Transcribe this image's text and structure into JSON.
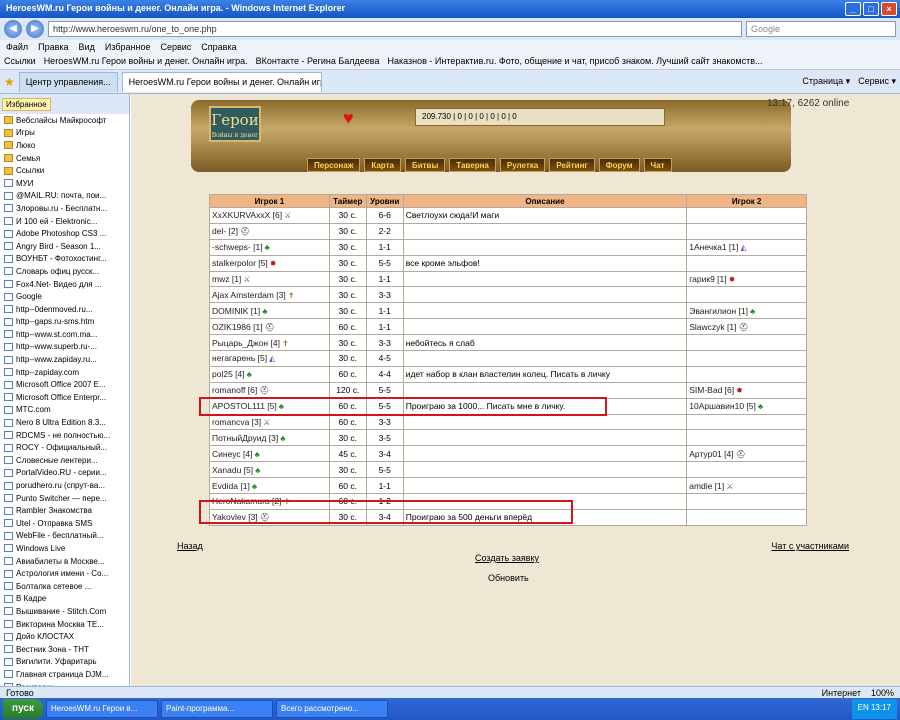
{
  "window": {
    "title": "HeroesWM.ru Герои войны и денег. Онлайн игра. - Windows Internet Explorer",
    "minimize": "_",
    "maximize": "□",
    "close": "×"
  },
  "address": {
    "url": "http://www.heroeswm.ru/one_to_one.php",
    "search_placeholder": "Google",
    "back": "◀",
    "forward": "▶"
  },
  "menu": [
    "Файл",
    "Правка",
    "Вид",
    "Избранное",
    "Сервис",
    "Справка"
  ],
  "links": [
    "Ссылки",
    "HeroesWM.ru Герои войны и денег. Онлайн игра.",
    "ВКонтакте - Регина Балдеева",
    "Наказнов - Интерактив.ru. Фото, общение и чат, присоб знаком. Лучший сайт знакомств..."
  ],
  "tabs": [
    "Центр управления...",
    "HeroesWM.ru Герои войны и денег. Онлайн игра."
  ],
  "tab_tools": [
    "Страница ▾",
    "Сервис ▾"
  ],
  "sidebar": {
    "fav_label": "Избранное",
    "items": [
      "Вебслайсы Майкрософт",
      "Игры",
      "Люко",
      "Семья",
      "Ссылки",
      "МУИ",
      "@MAIL.RU: почта, пои...",
      "Злоровы.ru - Бесплатн...",
      "И 100 ей - Elektronic...",
      "Adobe Photoshop CS3 ...",
      "Angry Bird - Season 1...",
      "ВОУНБТ - Фотохостинг...",
      "Словарь офиц русск...",
      "Fox4.Net- Видео для ...",
      "Google",
      "http--0denmoved.ru...",
      "http--gaps.ru-sms.htm",
      "http--www.st.com.ma...",
      "http--www.superb.ru-...",
      "http--www.zapiday.ru...",
      "http--zapiday.com",
      "Microsoft Office 2007 E...",
      "Microsoft Office Enterpr...",
      "МТС.com",
      "Nero 8 Ultra Edition 8.3...",
      "RDCMS - не полностью...",
      "ROCY - Официальный...",
      "Словесные лентери...",
      "PortalVideo.RU - серии...",
      "porudhero.ru (спрут-ва...",
      "Punto Switcher — пере...",
      "Rambler Знакомства",
      "Utel - Отправка SMS",
      "WebFile - бесплатный...",
      "Windows Live",
      "Авиабилеты в Москве...",
      "Астрология имени - Со...",
      "Болталка сетевое ...",
      "В Кадре",
      "Вышивание - Stitch.Com",
      "Викторина Москва ТЕ...",
      "Дойо КЛОСТАХ",
      "Вестник Зона - ТНТ",
      "Вигилити. Уфаритарь",
      "Главная страница DJM...",
      "Раскраски"
    ]
  },
  "game": {
    "logo": "Герои",
    "logo_sub": "Войны и денег",
    "heart_icon": "heart-icon",
    "resources": "209.730 | 0 | 0 | 0 | 0 | 0 | 0",
    "clock": "13:17, 6262 online",
    "nav": [
      "Персонаж",
      "Карта",
      "Битвы",
      "Таверна",
      "Рулетка",
      "Рейтинг",
      "Форум",
      "Чат"
    ]
  },
  "table": {
    "headers": [
      "Игрок 1",
      "Таймер",
      "Уровни",
      "Описание",
      "Игрок 2"
    ],
    "rows": [
      {
        "p1": "XxXKURVAxxX [6]",
        "i1": "sword",
        "t": "30 с.",
        "l": "6-6",
        "d": "Светлоухи сюда!И маги",
        "p2": "",
        "i2": ""
      },
      {
        "p1": "del- [2]",
        "i1": "helm",
        "t": "30 с.",
        "l": "2-2",
        "d": "",
        "p2": "",
        "i2": ""
      },
      {
        "p1": "-schweps- [1]",
        "i1": "tree",
        "t": "30 с.",
        "l": "1-1",
        "d": "",
        "p2": "1Анечка1 [1]",
        "i2": "mage"
      },
      {
        "p1": "stalkerpolor [5]",
        "i1": "star",
        "t": "30 с.",
        "l": "5-5",
        "d": "все кроме эльфов!",
        "p2": "",
        "i2": ""
      },
      {
        "p1": "mwz [1]",
        "i1": "sword",
        "t": "30 с.",
        "l": "1-1",
        "d": "",
        "p2": "гарик9 [1]",
        "i2": "star"
      },
      {
        "p1": "Ajax Amsterdam [3]",
        "i1": "cross",
        "t": "30 с.",
        "l": "3-3",
        "d": "",
        "p2": "",
        "i2": ""
      },
      {
        "p1": "DOMINIK [1]",
        "i1": "tree",
        "t": "30 с.",
        "l": "1-1",
        "d": "",
        "p2": "Эвангилион [1]",
        "i2": "tree"
      },
      {
        "p1": "OZIK1986 [1]",
        "i1": "helm",
        "t": "60 с.",
        "l": "1-1",
        "d": "",
        "p2": "Slawczyk [1]",
        "i2": "helm"
      },
      {
        "p1": "Рыцарь_Джон [4]",
        "i1": "cross",
        "t": "30 с.",
        "l": "3-3",
        "d": "небойтесь я слаб",
        "p2": "",
        "i2": ""
      },
      {
        "p1": "негагарень [5]",
        "i1": "mage",
        "t": "30 с.",
        "l": "4-5",
        "d": "",
        "p2": "",
        "i2": ""
      },
      {
        "p1": "pol25 [4]",
        "i1": "tree",
        "t": "60 с.",
        "l": "4-4",
        "d": "идет набор в клан властелин колец. Писать в личку",
        "p2": "",
        "i2": ""
      },
      {
        "p1": "romanoff [6]",
        "i1": "helm",
        "t": "120 с.",
        "l": "5-5",
        "d": "",
        "p2": "SIM-Bad [6]",
        "i2": "star"
      },
      {
        "p1": "APOSTOL111 [5]",
        "i1": "tree",
        "t": "60 с.",
        "l": "5-5",
        "d": "Проиграю за 1000... Писать мне в личку.",
        "p2": "10Аршавин10 [5]",
        "i2": "tree"
      },
      {
        "p1": "romancva [3]",
        "i1": "sword",
        "t": "60 с.",
        "l": "3-3",
        "d": "",
        "p2": "",
        "i2": ""
      },
      {
        "p1": "ПотныйДруид [3]",
        "i1": "tree",
        "t": "30 с.",
        "l": "3-5",
        "d": "",
        "p2": "",
        "i2": ""
      },
      {
        "p1": "Синеус [4]",
        "i1": "tree",
        "t": "45 с.",
        "l": "3-4",
        "d": "",
        "p2": "Артур01 [4]",
        "i2": "helm"
      },
      {
        "p1": "Xanadu [5]",
        "i1": "tree",
        "t": "30 с.",
        "l": "5-5",
        "d": "",
        "p2": "",
        "i2": ""
      },
      {
        "p1": "Evdida [1]",
        "i1": "tree",
        "t": "60 с.",
        "l": "1-1",
        "d": "",
        "p2": "amdie [1]",
        "i2": "sword"
      },
      {
        "p1": "HeroNakamura [2]",
        "i1": "cross",
        "t": "60 с.",
        "l": "1-2",
        "d": "",
        "p2": "",
        "i2": ""
      },
      {
        "p1": "Yakovlev [3]",
        "i1": "helm",
        "t": "30 с.",
        "l": "3-4",
        "d": "Проиграю за 500 деньги вперёд",
        "p2": "",
        "i2": ""
      }
    ]
  },
  "footer": {
    "back": "Назад",
    "create": "Создать заявку",
    "refresh": "Обновить",
    "chat": "Чат с участниками"
  },
  "status": {
    "left": "Готово",
    "zone": "Интернет",
    "zoom": "100%"
  },
  "taskbar": {
    "start": "пуск",
    "tasks": [
      "HeroesWM.ru Герои в...",
      "Paint-программа...",
      "Всего рассмотрено..."
    ],
    "tray": "EN  13:17"
  },
  "icons": {
    "tree": "♣",
    "helm": "⛑",
    "star": "✸",
    "sword": "⚔",
    "mage": "◭",
    "cross": "✝"
  }
}
